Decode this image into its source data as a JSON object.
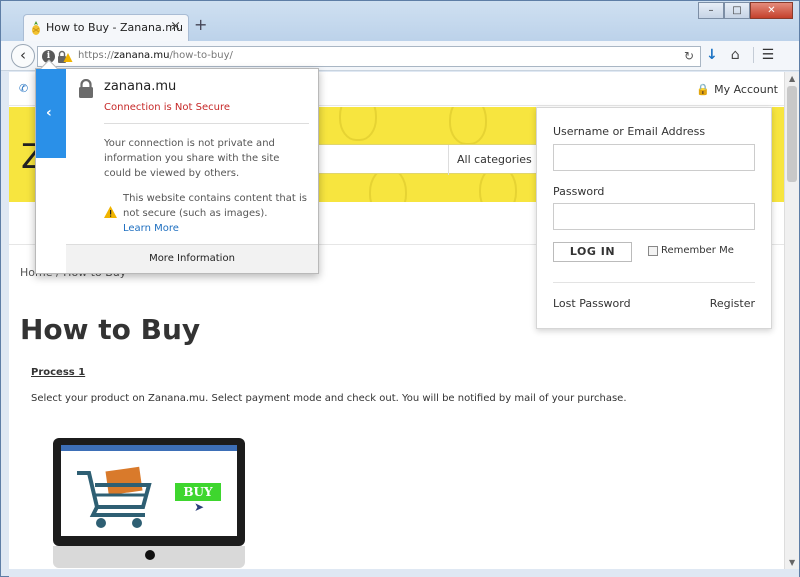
{
  "browser": {
    "tab_title": "How to Buy - Zanana.mu",
    "tab_close": "×",
    "new_tab": "+",
    "controls": {
      "minimize": "–",
      "maximize": "□",
      "close": "✕"
    },
    "url_prefix": "https://",
    "url_host": "zanana.mu",
    "url_path": "/how-to-buy/",
    "back_icon": "‹",
    "reload_icon": "↻",
    "download_icon": "↓",
    "home_icon": "⌂",
    "menu_icon": "☰",
    "favicon": "pineapple-icon",
    "accent": "#1b73c4"
  },
  "identity_popup": {
    "host": "zanana.mu",
    "status": "Connection is Not Secure",
    "description": "Your connection is not private and information you share with the site could be viewed by others.",
    "warning": "This website contains content that is not secure (such as images).",
    "learn_more": "Learn More",
    "more_info": "More Information",
    "status_color": "#c62828",
    "side_color": "#2a90e8"
  },
  "site": {
    "phone_icon": "phone-icon",
    "my_account": "My Account",
    "logo_fragment": "Z",
    "categories": "All categories",
    "breadcrumb": "Home / How to Buy",
    "page_title": "How to Buy",
    "process_heading": "Process 1",
    "process_text": "Select your product on Zanana.mu. Select payment mode and check out. You will be notified by mail of your purchase.",
    "buy_label": "BUY",
    "banner_color": "#f7e53f"
  },
  "login": {
    "username_label": "Username or Email Address",
    "username_value": "",
    "password_label": "Password",
    "password_value": "",
    "login_button": "LOG IN",
    "remember_label": "Remember Me",
    "remember_checked": false,
    "lost_password": "Lost Password",
    "register": "Register"
  }
}
